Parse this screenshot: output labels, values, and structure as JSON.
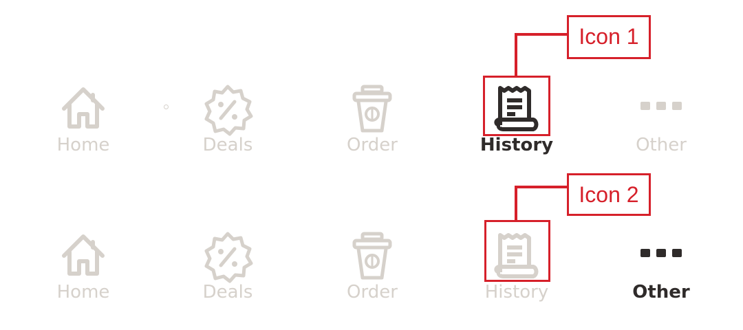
{
  "row1": {
    "items": [
      {
        "label": "Home",
        "icon": "home-icon",
        "active": false
      },
      {
        "label": "Deals",
        "icon": "discount-badge-icon",
        "active": false
      },
      {
        "label": "Order",
        "icon": "coffee-cup-icon",
        "active": false
      },
      {
        "label": "History",
        "icon": "receipt-icon",
        "active": true
      },
      {
        "label": "Other",
        "icon": "more-dots-icon",
        "active": false
      }
    ]
  },
  "row2": {
    "items": [
      {
        "label": "Home",
        "icon": "home-icon",
        "active": false
      },
      {
        "label": "Deals",
        "icon": "discount-badge-icon",
        "active": false
      },
      {
        "label": "Order",
        "icon": "coffee-cup-icon",
        "active": false
      },
      {
        "label": "History",
        "icon": "receipt-icon",
        "active": false
      },
      {
        "label": "Other",
        "icon": "more-dots-icon",
        "active": true
      }
    ]
  },
  "annotations": {
    "icon1": "Icon 1",
    "icon2": "Icon 2"
  },
  "colors": {
    "inactive": "#d6d1cb",
    "active": "#2f2b2a",
    "annotation": "#d6202a"
  }
}
